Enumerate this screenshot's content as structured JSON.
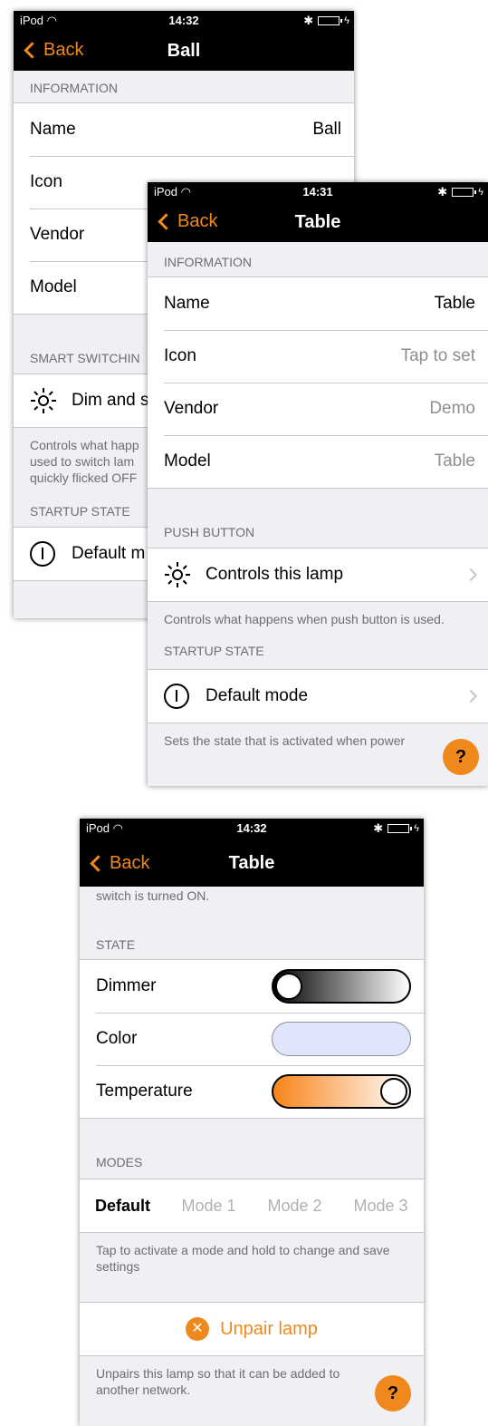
{
  "ball": {
    "status": {
      "carrier": "iPod",
      "time": "14:32"
    },
    "nav": {
      "back": "Back",
      "title": "Ball"
    },
    "info_header": "INFORMATION",
    "rows": [
      {
        "label": "Name",
        "value": "Ball"
      },
      {
        "label": "Icon",
        "value": ""
      },
      {
        "label": "Vendor",
        "value": ""
      },
      {
        "label": "Model",
        "value": ""
      }
    ],
    "smart_header": "SMART SWITCHIN",
    "smart_row": "Dim and s",
    "smart_footnote": "Controls what happ\nused to switch lam\nquickly flicked OFF",
    "startup_header": "STARTUP STATE",
    "startup_row": "Default m"
  },
  "table1": {
    "status": {
      "carrier": "iPod",
      "time": "14:31"
    },
    "nav": {
      "back": "Back",
      "title": "Table"
    },
    "info_header": "INFORMATION",
    "rows": [
      {
        "label": "Name",
        "value": "Table"
      },
      {
        "label": "Icon",
        "value": "Tap to set"
      },
      {
        "label": "Vendor",
        "value": "Demo"
      },
      {
        "label": "Model",
        "value": "Table"
      }
    ],
    "push_header": "PUSH BUTTON",
    "push_row": "Controls this lamp",
    "push_footnote": "Controls what happens when push button is used.",
    "startup_header": "STARTUP STATE",
    "startup_row": "Default mode",
    "startup_footnote": "Sets the state that is activated when power",
    "help": "?"
  },
  "table2": {
    "status": {
      "carrier": "iPod",
      "time": "14:32"
    },
    "nav": {
      "back": "Back",
      "title": "Table"
    },
    "top_note": "switch is turned ON.",
    "state_header": "STATE",
    "state_rows": [
      {
        "label": "Dimmer",
        "level": 0.0
      },
      {
        "label": "Color"
      },
      {
        "label": "Temperature",
        "level": 1.0
      }
    ],
    "modes_header": "MODES",
    "modes": [
      "Default",
      "Mode 1",
      "Mode 2",
      "Mode 3"
    ],
    "active_mode": "Default",
    "modes_footnote": "Tap to activate a mode and hold to change and save settings",
    "unpair_label": "Unpair lamp",
    "unpair_footnote": "Unpairs this lamp so that it can be added to another network.",
    "help": "?"
  },
  "colors": {
    "accent": "#f0891d",
    "color_swatch": "#dfe6fb",
    "battery": "#4cd964"
  }
}
